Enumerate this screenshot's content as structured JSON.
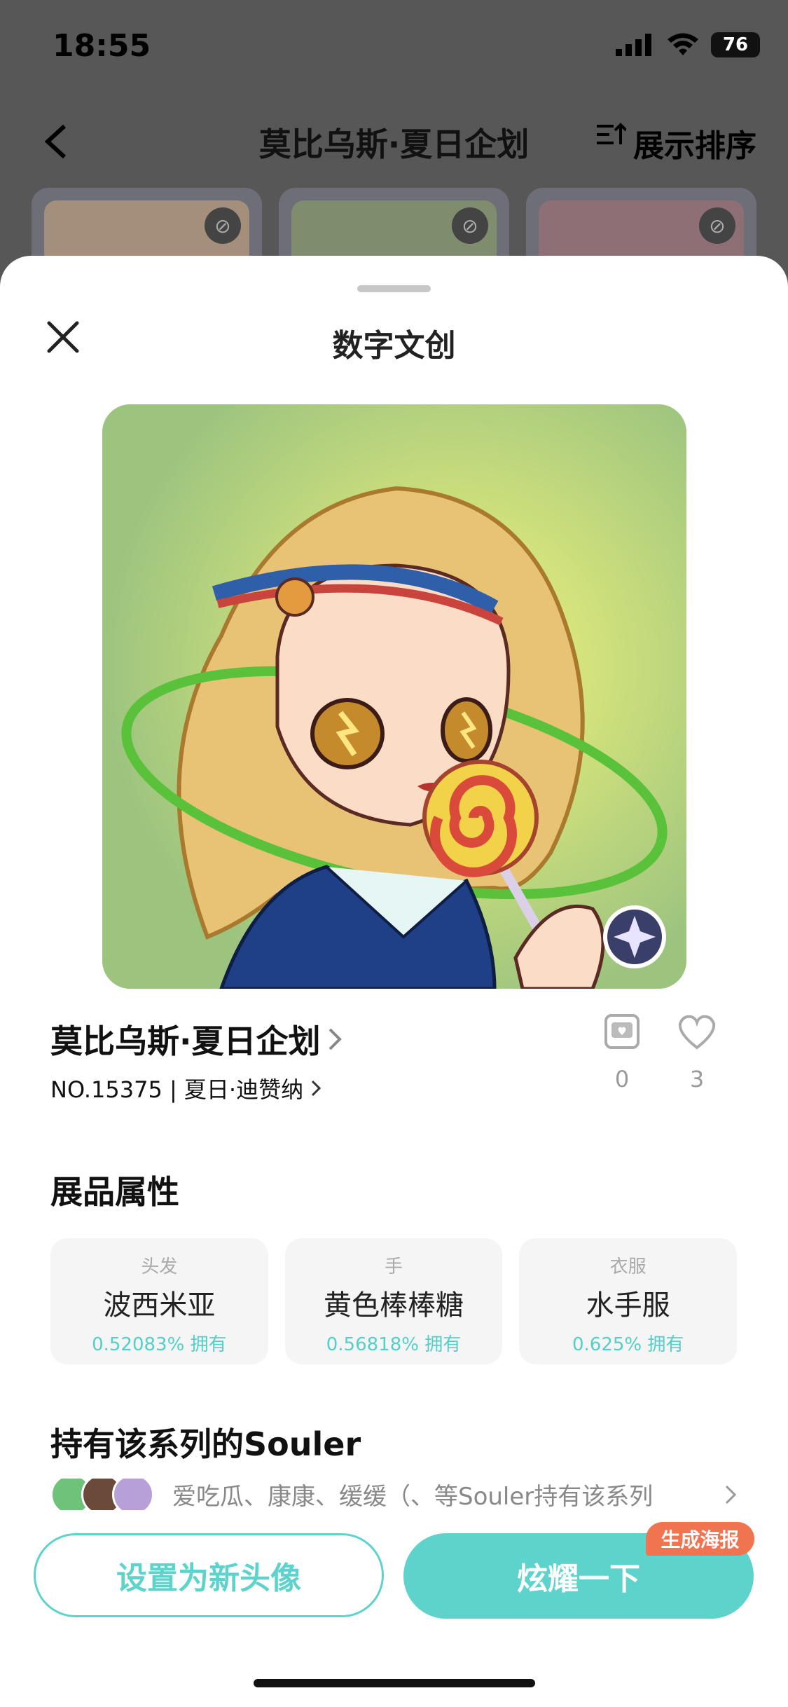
{
  "status_bar": {
    "time": "18:55",
    "battery": "76"
  },
  "nav": {
    "title": "莫比乌斯·夏日企划",
    "sort_label": "展示排序"
  },
  "sheet": {
    "title": "数字文创",
    "item_title": "莫比乌斯·夏日企划",
    "item_sub": "NO.15375 | 夏日·迪赞纳",
    "collect_count": "0",
    "like_count": "3",
    "attributes_title": "展品属性",
    "attributes": [
      {
        "category": "头发",
        "name": "波西米亚",
        "percent": "0.52083% 拥有"
      },
      {
        "category": "手",
        "name": "黄色棒棒糖",
        "percent": "0.56818% 拥有"
      },
      {
        "category": "衣服",
        "name": "水手服",
        "percent": "0.625% 拥有"
      }
    ],
    "owners_title": "持有该系列的Souler",
    "owners_text": "爱吃瓜、康康、缓缓（、等Souler持有该系列",
    "set_avatar_label": "设置为新头像",
    "show_off_label": "炫耀一下",
    "poster_badge": "生成海报"
  },
  "colors": {
    "accent": "#5dd3cc",
    "badge": "#f0744f"
  }
}
